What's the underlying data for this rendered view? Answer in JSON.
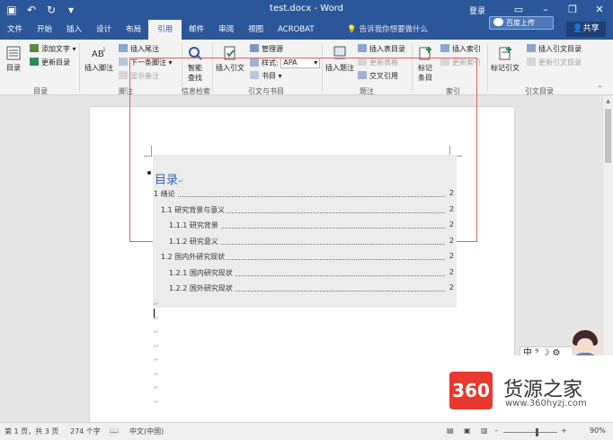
{
  "title_bar": {
    "document_title": "test.docx - Word",
    "login": "登录",
    "qat": {
      "save_icon": "save-icon",
      "undo_icon": "undo-icon",
      "redo_icon": "redo-icon"
    }
  },
  "tabs": [
    {
      "label": "文件"
    },
    {
      "label": "开始"
    },
    {
      "label": "插入"
    },
    {
      "label": "设计"
    },
    {
      "label": "布局"
    },
    {
      "label": "引用",
      "active": true
    },
    {
      "label": "邮件"
    },
    {
      "label": "审阅"
    },
    {
      "label": "视图"
    },
    {
      "label": "ACROBAT"
    }
  ],
  "tell_me": "告诉我你想要做什么",
  "baidu_upload": "百度上传",
  "share": "共享",
  "ribbon": {
    "toc": {
      "big": "目录",
      "add_text": "添加文字",
      "update": "更新目录",
      "group": "目录"
    },
    "footnote": {
      "big": "插入脚注",
      "insert_endnote": "插入尾注",
      "next_footnote": "下一条脚注",
      "show_notes": "显示备注",
      "group": "脚注"
    },
    "research": {
      "big1": "智能",
      "big2": "查找",
      "group": "信息检索"
    },
    "citation": {
      "big": "插入引文",
      "manage_sources": "管理源",
      "style_label": "样式:",
      "style_value": "APA",
      "bibliography": "书目",
      "group": "引文与书目"
    },
    "captions": {
      "big": "插入题注",
      "insert_tof": "插入表目录",
      "update_table": "更新表格",
      "cross_ref": "交叉引用",
      "group": "题注"
    },
    "index": {
      "big1": "标记",
      "big2": "条目",
      "insert_index": "插入索引",
      "update_index": "更新索引",
      "group": "索引"
    },
    "toa": {
      "big": "标记引文",
      "insert_toa": "插入引文目录",
      "update_toa": "更新引文目录",
      "group": "引文目录"
    }
  },
  "document": {
    "toc_title": "目录",
    "para_mark": "↵",
    "toc_entries": [
      {
        "text": "1 绪论",
        "page": "2",
        "level": 1
      },
      {
        "text": "1.1 研究背景与意义",
        "page": "2",
        "level": 2
      },
      {
        "text": "1.1.1 研究背景",
        "page": "2",
        "level": 3
      },
      {
        "text": "1.1.2 研究意义",
        "page": "2",
        "level": 3
      },
      {
        "text": "1.2 国内外研究现状",
        "page": "2",
        "level": 2
      },
      {
        "text": "1.2.1 国内研究现状",
        "page": "2",
        "level": 3
      },
      {
        "text": "1.2.2 国外研究现状",
        "page": "2",
        "level": 3
      }
    ]
  },
  "ime": "中 ⁹ ☽ ⚙",
  "watermark": {
    "logo": "360",
    "name": "货源之家",
    "url": "www.360hyzj.com"
  },
  "status_bar": {
    "page": "第 1 页，共 3 页",
    "words": "274 个字",
    "language": "中文(中国)",
    "zoom": "90%"
  },
  "colors": {
    "title_blue": "#2b579a",
    "toc_title": "#3a63a8",
    "frame_red": "#e06060",
    "logo_red": "#e8382f"
  }
}
